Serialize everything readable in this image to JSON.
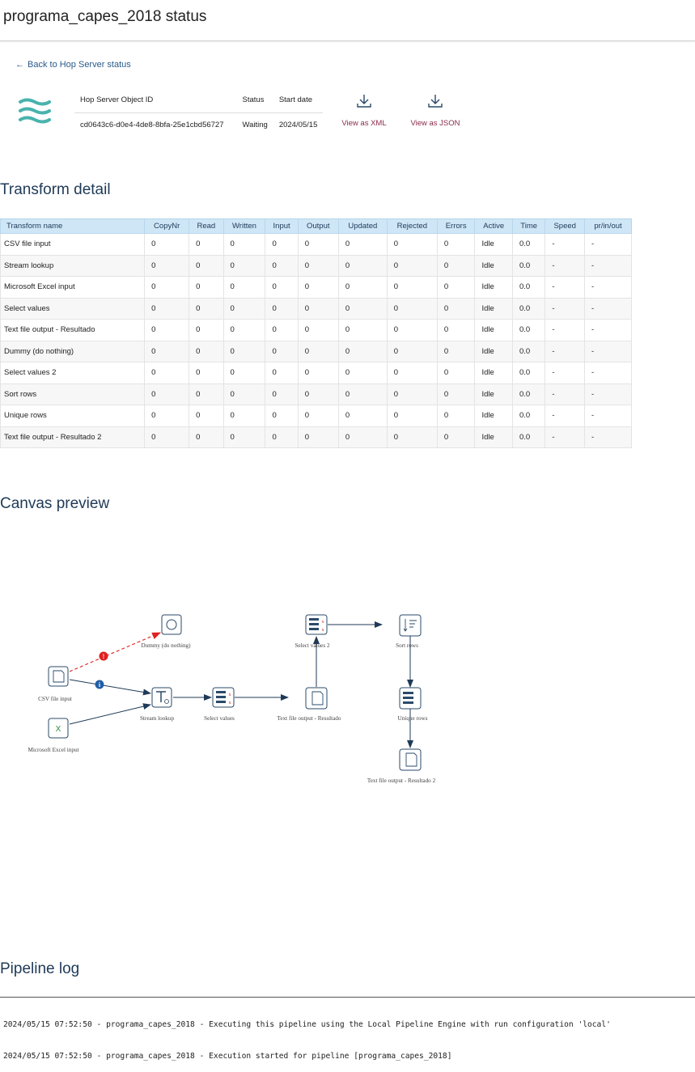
{
  "header": {
    "title": "programa_capes_2018 status"
  },
  "back_link": {
    "label": "Back to Hop Server status"
  },
  "info": {
    "headers": {
      "object_id": "Hop Server Object ID",
      "status": "Status",
      "start_date": "Start date"
    },
    "object_id": "cd0643c6-d0e4-4de8-8bfa-25e1cbd56727",
    "status": "Waiting",
    "start_date": "2024/05/15",
    "status_color": "#e8a33a"
  },
  "downloads": {
    "xml_label": "View as XML",
    "json_label": "View as JSON"
  },
  "transform_detail": {
    "title": "Transform detail",
    "columns": [
      "Transform name",
      "CopyNr",
      "Read",
      "Written",
      "Input",
      "Output",
      "Updated",
      "Rejected",
      "Errors",
      "Active",
      "Time",
      "Speed",
      "pr/in/out"
    ],
    "rows": [
      [
        "CSV file input",
        "0",
        "0",
        "0",
        "0",
        "0",
        "0",
        "0",
        "0",
        "Idle",
        "0.0",
        "-",
        "-"
      ],
      [
        "Stream lookup",
        "0",
        "0",
        "0",
        "0",
        "0",
        "0",
        "0",
        "0",
        "Idle",
        "0.0",
        "-",
        "-"
      ],
      [
        "Microsoft Excel input",
        "0",
        "0",
        "0",
        "0",
        "0",
        "0",
        "0",
        "0",
        "Idle",
        "0.0",
        "-",
        "-"
      ],
      [
        "Select values",
        "0",
        "0",
        "0",
        "0",
        "0",
        "0",
        "0",
        "0",
        "Idle",
        "0.0",
        "-",
        "-"
      ],
      [
        "Text file output - Resultado",
        "0",
        "0",
        "0",
        "0",
        "0",
        "0",
        "0",
        "0",
        "Idle",
        "0.0",
        "-",
        "-"
      ],
      [
        "Dummy (do nothing)",
        "0",
        "0",
        "0",
        "0",
        "0",
        "0",
        "0",
        "0",
        "Idle",
        "0.0",
        "-",
        "-"
      ],
      [
        "Select values 2",
        "0",
        "0",
        "0",
        "0",
        "0",
        "0",
        "0",
        "0",
        "Idle",
        "0.0",
        "-",
        "-"
      ],
      [
        "Sort rows",
        "0",
        "0",
        "0",
        "0",
        "0",
        "0",
        "0",
        "0",
        "Idle",
        "0.0",
        "-",
        "-"
      ],
      [
        "Unique rows",
        "0",
        "0",
        "0",
        "0",
        "0",
        "0",
        "0",
        "0",
        "Idle",
        "0.0",
        "-",
        "-"
      ],
      [
        "Text file output - Resultado 2",
        "0",
        "0",
        "0",
        "0",
        "0",
        "0",
        "0",
        "0",
        "Idle",
        "0.0",
        "-",
        "-"
      ]
    ]
  },
  "canvas": {
    "title": "Canvas preview",
    "nodes": {
      "csv": "CSV file input",
      "excel": "Microsoft Excel input",
      "lookup": "Stream lookup",
      "dummy": "Dummy (do nothing)",
      "select": "Select values",
      "textout": "Text file output - Resultado",
      "select2": "Select values 2",
      "sort": "Sort rows",
      "unique": "Unique rows",
      "textout2": "Text file output - Resultado 2"
    }
  },
  "pipeline_log": {
    "title": "Pipeline log",
    "lines": [
      "2024/05/15 07:52:50 - programa_capes_2018 - Executing this pipeline using the Local Pipeline Engine with run configuration 'local'",
      "2024/05/15 07:52:50 - programa_capes_2018 - Execution started for pipeline [programa_capes_2018]"
    ]
  }
}
